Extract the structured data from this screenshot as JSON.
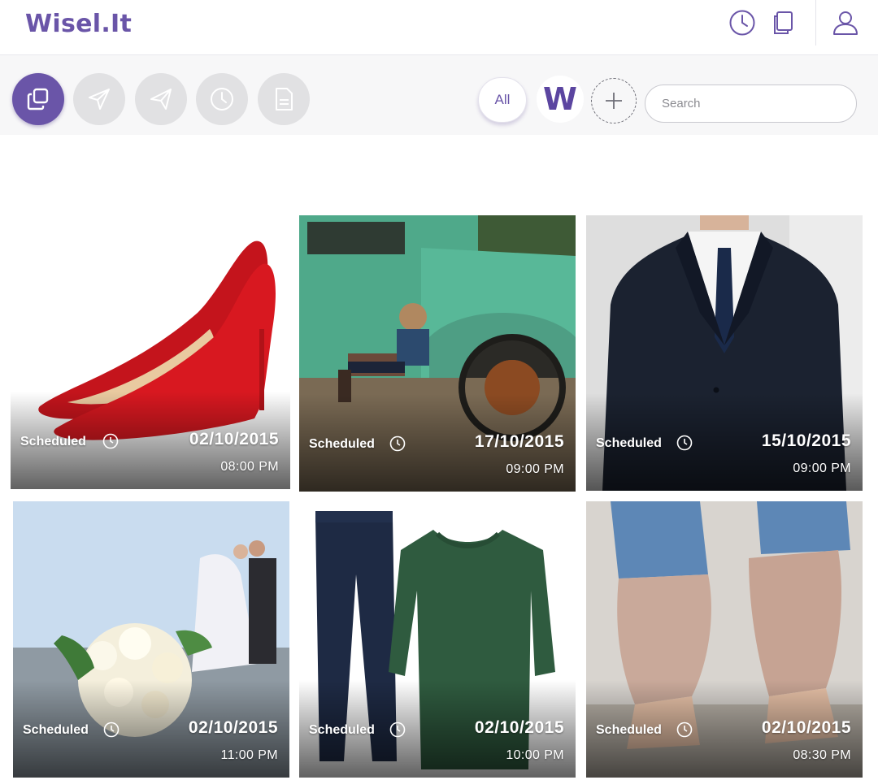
{
  "app": {
    "logo": "Wisel.It",
    "accent": "#6a55a8"
  },
  "header": {
    "icons": [
      "clock-icon",
      "copy-icon",
      "user-icon"
    ]
  },
  "toolbar": {
    "buttons": [
      "copy-icon",
      "send-icon",
      "reply-send-icon",
      "clock-icon",
      "document-icon"
    ],
    "active_index": 0,
    "filter_all": "All",
    "brand_initial": "W",
    "search_placeholder": "Search"
  },
  "posts": [
    {
      "subject": "red-spiked-heels",
      "status": "Scheduled",
      "date": "02/10/2015",
      "time": "08:00 PM"
    },
    {
      "subject": "child-on-green-truck",
      "status": "Scheduled",
      "date": "17/10/2015",
      "time": "09:00 PM"
    },
    {
      "subject": "navy-suit",
      "status": "Scheduled",
      "date": "15/10/2015",
      "time": "09:00 PM"
    },
    {
      "subject": "wedding-bouquet",
      "status": "Scheduled",
      "date": "02/10/2015",
      "time": "11:00 PM"
    },
    {
      "subject": "jeans-and-green-sweater",
      "status": "Scheduled",
      "date": "02/10/2015",
      "time": "10:00 PM"
    },
    {
      "subject": "fringe-heels",
      "status": "Scheduled",
      "date": "02/10/2015",
      "time": "08:30 PM"
    }
  ]
}
